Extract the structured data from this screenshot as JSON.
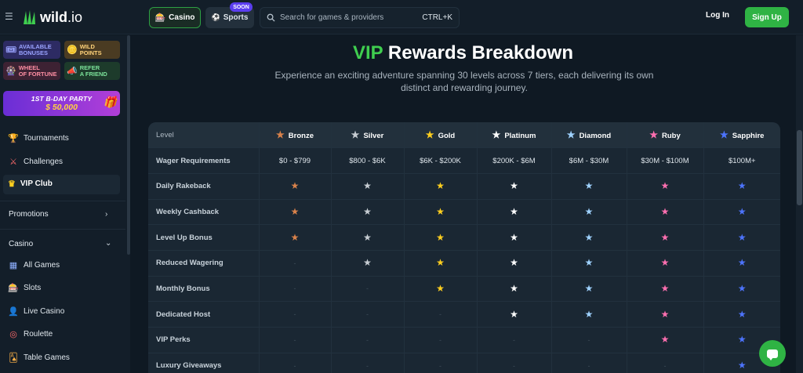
{
  "header": {
    "logo_text": "wild",
    "logo_suffix": ".io",
    "nav": [
      {
        "label": "Casino",
        "icon": "dice-icon",
        "active": true
      },
      {
        "label": "Sports",
        "icon": "ball-icon",
        "badge": "SOON"
      }
    ],
    "search_placeholder": "Search for games & providers",
    "search_shortcut": "CTRL+K",
    "login_label": "Log In",
    "signup_label": "Sign Up"
  },
  "sidebar": {
    "tiles": [
      {
        "line1": "AVAILABLE",
        "line2": "BONUSES",
        "icon": "ticket-icon"
      },
      {
        "line1": "WILD",
        "line2": "POINTS",
        "icon": "coin-icon"
      },
      {
        "line1": "WHEEL",
        "line2": "OF FORTUNE",
        "icon": "wheel-icon"
      },
      {
        "line1": "REFER",
        "line2": "A FRIEND",
        "icon": "megaphone-icon"
      }
    ],
    "banner": {
      "line1": "1ST B-DAY PARTY",
      "line2": "$ 50,000"
    },
    "items": [
      {
        "label": "Tournaments",
        "icon": "trophy-icon"
      },
      {
        "label": "Challenges",
        "icon": "swords-icon"
      },
      {
        "label": "VIP Club",
        "icon": "crown-icon",
        "active": true
      }
    ],
    "promotions_label": "Promotions",
    "casino_label": "Casino",
    "casino_items": [
      {
        "label": "All Games",
        "icon": "grid-icon"
      },
      {
        "label": "Slots",
        "icon": "slot-icon"
      },
      {
        "label": "Live Casino",
        "icon": "dealer-icon"
      },
      {
        "label": "Roulette",
        "icon": "roulette-icon"
      },
      {
        "label": "Table Games",
        "icon": "cards-icon"
      }
    ]
  },
  "main": {
    "title_highlight": "VIP",
    "title_rest": "Rewards Breakdown",
    "subtitle": "Experience an exciting adventure spanning 30 levels across 7 tiers, each delivering its own distinct and rewarding journey.",
    "table": {
      "level_header": "Level",
      "tiers": [
        {
          "name": "Bronze",
          "color": "#d9824b"
        },
        {
          "name": "Silver",
          "color": "#c7cdd3"
        },
        {
          "name": "Gold",
          "color": "#ffcf1f"
        },
        {
          "name": "Platinum",
          "color": "#ffffff"
        },
        {
          "name": "Diamond",
          "color": "#9fd2ff"
        },
        {
          "name": "Ruby",
          "color": "#ff6fb0"
        },
        {
          "name": "Sapphire",
          "color": "#4d74ff"
        }
      ],
      "wager_label": "Wager Requirements",
      "wager_values": [
        "$0 - $799",
        "$800 - $6K",
        "$6K - $200K",
        "$200K - $6M",
        "$6M - $30M",
        "$30M - $100M",
        "$100M+"
      ],
      "rows": [
        {
          "label": "Daily Rakeback",
          "tiers": [
            1,
            1,
            1,
            1,
            1,
            1,
            1
          ]
        },
        {
          "label": "Weekly Cashback",
          "tiers": [
            1,
            1,
            1,
            1,
            1,
            1,
            1
          ]
        },
        {
          "label": "Level Up Bonus",
          "tiers": [
            1,
            1,
            1,
            1,
            1,
            1,
            1
          ]
        },
        {
          "label": "Reduced Wagering",
          "tiers": [
            0,
            1,
            1,
            1,
            1,
            1,
            1
          ]
        },
        {
          "label": "Monthly Bonus",
          "tiers": [
            0,
            0,
            1,
            1,
            1,
            1,
            1
          ]
        },
        {
          "label": "Dedicated Host",
          "tiers": [
            0,
            0,
            0,
            1,
            1,
            1,
            1
          ]
        },
        {
          "label": "VIP Perks",
          "tiers": [
            0,
            0,
            0,
            0,
            0,
            1,
            1
          ]
        },
        {
          "label": "Luxury Giveaways",
          "tiers": [
            0,
            0,
            0,
            0,
            0,
            0,
            1
          ]
        }
      ],
      "dash": "-"
    }
  }
}
